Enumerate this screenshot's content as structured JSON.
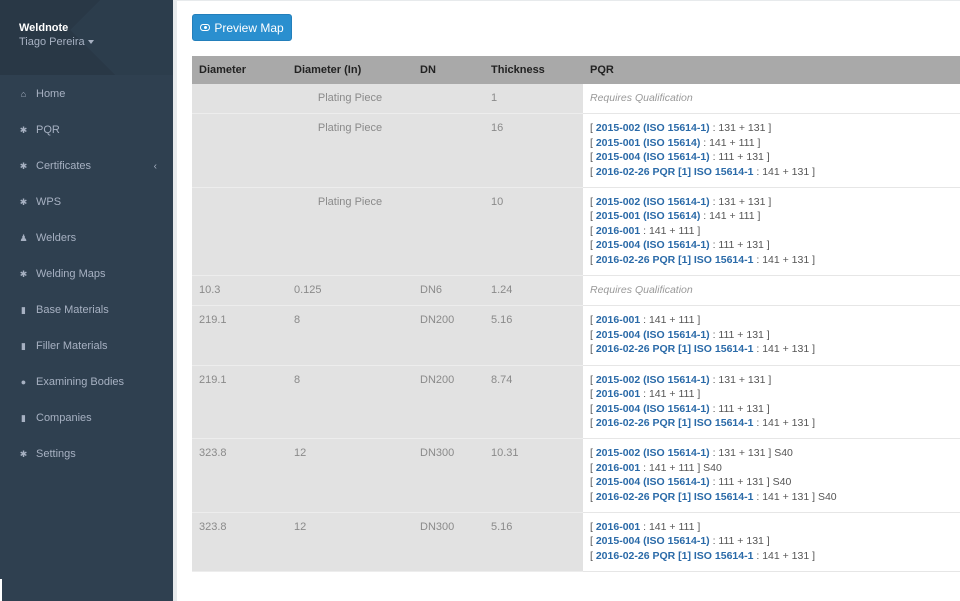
{
  "sidebar": {
    "brand": "Weldnote",
    "user": "Tiago Pereira",
    "items": [
      {
        "label": "Home",
        "icon": "home-icon"
      },
      {
        "label": "PQR",
        "icon": "gear-icon"
      },
      {
        "label": "Certificates",
        "icon": "gear-icon",
        "expandable": true
      },
      {
        "label": "WPS",
        "icon": "gear-icon"
      },
      {
        "label": "Welders",
        "icon": "user-icon"
      },
      {
        "label": "Welding Maps",
        "icon": "gear-icon"
      },
      {
        "label": "Base Materials",
        "icon": "book-icon"
      },
      {
        "label": "Filler Materials",
        "icon": "book-icon"
      },
      {
        "label": "Examining Bodies",
        "icon": "circle-icon"
      },
      {
        "label": "Companies",
        "icon": "book-icon"
      },
      {
        "label": "Settings",
        "icon": "gear-icon"
      }
    ]
  },
  "main": {
    "preview_button": "Preview Map",
    "columns": [
      "Diameter",
      "Diameter (In)",
      "DN",
      "Thickness",
      "PQR"
    ],
    "rows": [
      {
        "diameter": "",
        "diameter_in": "Plating Piece",
        "dn": "",
        "thickness": "1",
        "requires": "Requires Qualification",
        "pqrs": []
      },
      {
        "diameter": "",
        "diameter_in": "Plating Piece",
        "dn": "",
        "thickness": "16",
        "pqrs": [
          {
            "code": "2015-002 (ISO 15614-1)",
            "process": " : 131 + 131 ",
            "suffix": "]"
          },
          {
            "code": "2015-001 (ISO 15614)",
            "process": " : 141 + 111 ",
            "suffix": "]"
          },
          {
            "code": "2015-004 (ISO 15614-1)",
            "process": " : 111 + 131 ",
            "suffix": "]"
          },
          {
            "code": "2016-02-26 PQR [1] ISO 15614-1",
            "process": " : 141 + 131 ",
            "suffix": "]"
          }
        ]
      },
      {
        "diameter": "",
        "diameter_in": "Plating Piece",
        "dn": "",
        "thickness": "10",
        "pqrs": [
          {
            "code": "2015-002 (ISO 15614-1)",
            "process": " : 131 + 131 ",
            "suffix": "]"
          },
          {
            "code": "2015-001 (ISO 15614)",
            "process": " : 141 + 111 ",
            "suffix": "]"
          },
          {
            "code": "2016-001",
            "process": " : 141 + 111 ",
            "suffix": "]"
          },
          {
            "code": "2015-004 (ISO 15614-1)",
            "process": " : 111 + 131 ",
            "suffix": "]"
          },
          {
            "code": "2016-02-26 PQR [1] ISO 15614-1",
            "process": " : 141 + 131 ",
            "suffix": "]"
          }
        ]
      },
      {
        "diameter": "10.3",
        "diameter_in": "0.125",
        "dn": "DN6",
        "thickness": "1.24",
        "requires": "Requires Qualification",
        "pqrs": []
      },
      {
        "diameter": "219.1",
        "diameter_in": "8",
        "dn": "DN200",
        "thickness": "5.16",
        "pqrs": [
          {
            "code": "2016-001",
            "process": " : 141 + 111 ",
            "suffix": "]"
          },
          {
            "code": "2015-004 (ISO 15614-1)",
            "process": " : 111 + 131 ",
            "suffix": "]"
          },
          {
            "code": "2016-02-26 PQR [1] ISO 15614-1",
            "process": " : 141 + 131 ",
            "suffix": "]"
          }
        ]
      },
      {
        "diameter": "219.1",
        "diameter_in": "8",
        "dn": "DN200",
        "thickness": "8.74",
        "pqrs": [
          {
            "code": "2015-002 (ISO 15614-1)",
            "process": " : 131 + 131 ",
            "suffix": "]"
          },
          {
            "code": "2016-001",
            "process": " : 141 + 111 ",
            "suffix": "]"
          },
          {
            "code": "2015-004 (ISO 15614-1)",
            "process": " : 111 + 131 ",
            "suffix": "]"
          },
          {
            "code": "2016-02-26 PQR [1] ISO 15614-1",
            "process": " : 141 + 131 ",
            "suffix": "]"
          }
        ]
      },
      {
        "diameter": "323.8",
        "diameter_in": "12",
        "dn": "DN300",
        "thickness": "10.31",
        "pqrs": [
          {
            "code": "2015-002 (ISO 15614-1)",
            "process": " : 131 + 131 ",
            "suffix": "] S40"
          },
          {
            "code": "2016-001",
            "process": " : 141 + 111 ",
            "suffix": "] S40"
          },
          {
            "code": "2015-004 (ISO 15614-1)",
            "process": " : 111 + 131 ",
            "suffix": "] S40"
          },
          {
            "code": "2016-02-26 PQR [1] ISO 15614-1",
            "process": " : 141 + 131 ",
            "suffix": "] S40"
          }
        ]
      },
      {
        "diameter": "323.8",
        "diameter_in": "12",
        "dn": "DN300",
        "thickness": "5.16",
        "pqrs": [
          {
            "code": "2016-001",
            "process": " : 141 + 111 ",
            "suffix": "]"
          },
          {
            "code": "2015-004 (ISO 15614-1)",
            "process": " : 111 + 131 ",
            "suffix": "]"
          },
          {
            "code": "2016-02-26 PQR [1] ISO 15614-1",
            "process": " : 141 + 131 ",
            "suffix": "]"
          }
        ]
      }
    ]
  },
  "colors": {
    "sidebar_bg": "#2f4050",
    "brand_bg": "#293846",
    "accent_button": "#2a8fcf",
    "link": "#2a6aa8",
    "header_bg": "#a9a9a9",
    "cell_gray": "#e2e2e2"
  }
}
